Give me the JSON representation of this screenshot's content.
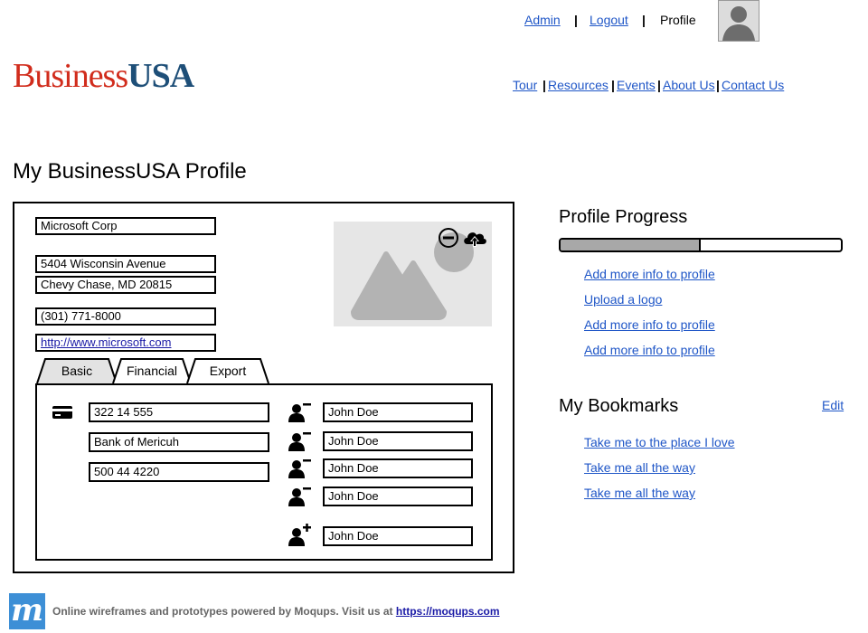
{
  "header": {
    "admin": "Admin",
    "logout": "Logout",
    "separator": "|",
    "profile": "Profile",
    "logo_part1": "Business",
    "logo_part2": "USA",
    "menu": [
      "Tour",
      "Resources",
      "Events",
      "About Us",
      "Contact Us"
    ]
  },
  "page_title": "My BusinessUSA Profile",
  "company": {
    "name": "Microsoft Corp",
    "address1": "5404 Wisconsin Avenue",
    "address2": "Chevy Chase, MD 20815",
    "phone": "(301) 771-8000",
    "website": "http://www.microsoft.com"
  },
  "tabs": [
    "Basic",
    "Financial",
    "Export"
  ],
  "active_tab": "Basic",
  "basic": {
    "fields": [
      "322 14 555",
      "Bank of Mericuh",
      "500 44 4220"
    ],
    "contacts": [
      "John Doe",
      "John Doe",
      "John Doe",
      "John Doe"
    ],
    "new_contact": "John Doe"
  },
  "progress": {
    "title": "Profile Progress",
    "percent": 50,
    "links": [
      "Add more info to profile",
      "Upload a logo",
      "Add more info to profile",
      "Add more info to profile"
    ]
  },
  "bookmarks": {
    "title": "My Bookmarks",
    "edit": "Edit",
    "links": [
      "Take me to the place I love",
      "Take me all the way",
      "Take me all the way"
    ]
  },
  "footer": {
    "logo_letter": "m",
    "text": "Online wireframes and prototypes powered by Moqups. Visit us at",
    "link": "https://moqups.com"
  },
  "colors": {
    "link": "#1f56c7",
    "logo_red": "#d12c1c",
    "logo_blue": "#1e4f78",
    "progress_fill": "#a8a8a8",
    "moqups_blue": "#3d8fd6"
  },
  "icons": [
    "user-avatar-icon",
    "image-placeholder-icon",
    "remove-image-icon",
    "upload-cloud-icon",
    "credit-card-icon",
    "remove-user-icon",
    "add-user-icon"
  ]
}
